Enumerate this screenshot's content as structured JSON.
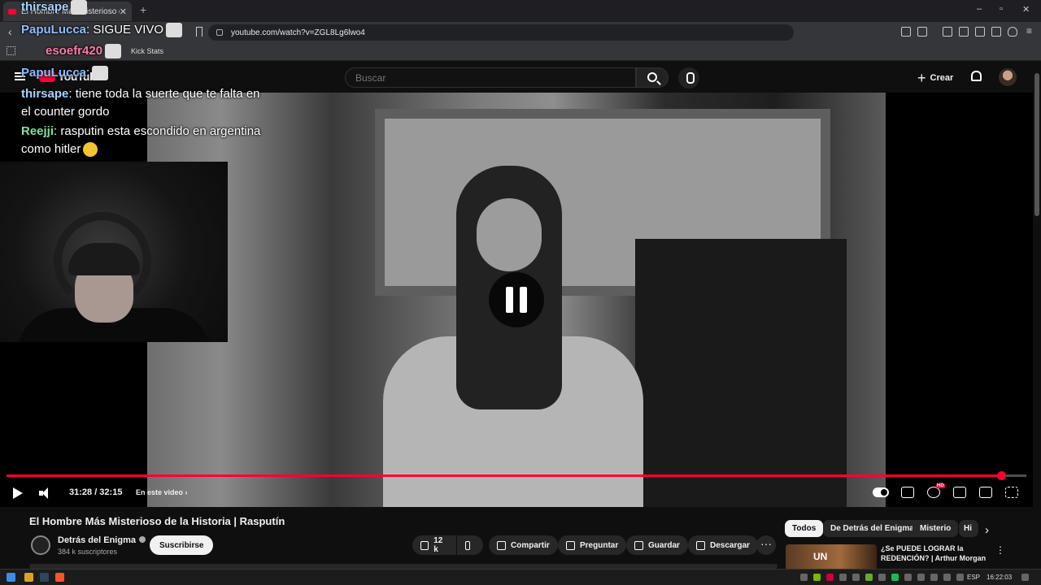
{
  "browser": {
    "tab_title": "El Hombre Más Misterioso de",
    "new_tab": "+",
    "url": "youtube.com/watch?v=ZGL8Lg6lwo4",
    "bookmark": "Kick Stats",
    "window_minimize": "–",
    "window_restore": "▫",
    "window_close": "✕"
  },
  "youtube": {
    "logo_text": "YouTube",
    "search_placeholder": "Buscar",
    "create_label": "Crear"
  },
  "chat": [
    {
      "user": "thirsape",
      "message": ""
    },
    {
      "user": "PapuLucca",
      "message": ": SIGUE VIVO"
    },
    {
      "user": "esoefr420",
      "message": ""
    },
    {
      "user": "PapuLucca",
      "message": ":"
    },
    {
      "user": "thirsape",
      "message": ": tiene toda la suerte que te falta en"
    },
    {
      "user": "",
      "message": "el counter gordo"
    },
    {
      "user": "Reejji",
      "message": ": rasputin esta escondido en argentina"
    },
    {
      "user": "",
      "message": "como hitler"
    }
  ],
  "player": {
    "current_time": "31:28",
    "duration": "32:15",
    "timecode": "31:28 / 32:15",
    "progress": 0.9755,
    "chapter_label": "En este video",
    "quality_badge": "HD"
  },
  "video": {
    "title": "El Hombre Más Misterioso de la Historia | Rasputín",
    "channel_name": "Detrás del Enigma",
    "subscribers": "384 k suscriptores",
    "subscribe_label": "Suscribirse",
    "likes": "12 k",
    "share_label": "Compartir",
    "ask_label": "Preguntar",
    "save_label": "Guardar",
    "download_label": "Descargar",
    "more_label": "···"
  },
  "chips": [
    "Todos",
    "De Detrás del Enigma",
    "Misterio",
    "Hi"
  ],
  "recommendation": {
    "thumb_text": "UN",
    "title": "¿Se PUEDE LOGRAR la REDENCIÓN? | Arthur Morgan ..."
  },
  "taskbar": {
    "language": "ESP",
    "clock": "16:22:03"
  },
  "colors": {
    "accent": "#ff0033",
    "background": "#0f0f0f",
    "chip_bg": "#272727"
  }
}
